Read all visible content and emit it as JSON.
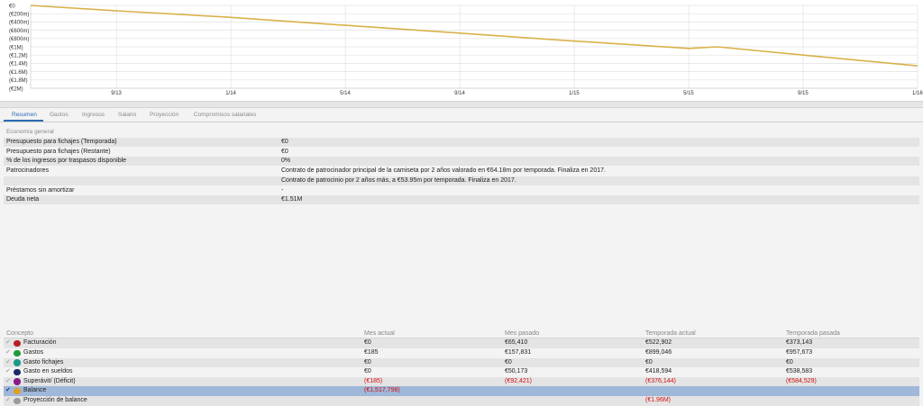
{
  "chart_data": {
    "type": "line",
    "x": [
      "6/13",
      "9/13",
      "1/14",
      "5/14",
      "9/14",
      "1/15",
      "5/15",
      "6/15",
      "9/15",
      "1/16"
    ],
    "y": [
      0,
      -130000,
      -290000,
      -480000,
      -670000,
      -860000,
      -1040000,
      -1000000,
      -1200000,
      -1460000
    ],
    "y_ticks": [
      "€0",
      "(€200m)",
      "(€400m)",
      "(€600m)",
      "(€800m)",
      "(€1M)",
      "(€1.2M)",
      "(€1.4M)",
      "(€1.6M)",
      "(€1.8M)",
      "(€2M)"
    ],
    "x_ticks": [
      "9/13",
      "1/14",
      "5/14",
      "9/14",
      "1/15",
      "5/15",
      "9/15",
      "1/16"
    ],
    "ylim": [
      -2000000,
      0
    ],
    "grid": true,
    "line_color": "#d9b14a"
  },
  "tabs": [
    "Resumen",
    "Gastos",
    "Ingresos",
    "Salario",
    "Proyección",
    "Compromisos salariales"
  ],
  "economia": {
    "title": "Economía general",
    "rows": [
      {
        "label": "Presupuesto para fichajes (Temporada)",
        "value": "€0"
      },
      {
        "label": "Presupuesto para fichajes (Restante)",
        "value": "€0"
      },
      {
        "label": "% de los ingresos por traspasos disponible",
        "value": "0%"
      },
      {
        "label": "Patrocinadores",
        "value": "Contrato de patrocinador principal de la camiseta por 2 años valorado en €64.18m por temporada. Finaliza en 2017."
      },
      {
        "label": "",
        "value": "Contrato de patrocinio por 2 años más, a €53.95m por temporada. Finaliza en 2017."
      },
      {
        "label": "Préstamos sin amortizar",
        "value": "-"
      },
      {
        "label": "Deuda neta",
        "value": "€1.51M"
      }
    ]
  },
  "table": {
    "headers": [
      "Concepto",
      "Mes actual",
      "Mes pasado",
      "Temporada actual",
      "Temporada pasada"
    ],
    "rows": [
      {
        "label": "Facturación",
        "color": "#b82020",
        "values": [
          "€0",
          "€65,410",
          "€522,902",
          "€373,143"
        ]
      },
      {
        "label": "Gastos",
        "color": "#1f9a3a",
        "values": [
          "€185",
          "€157,831",
          "€899,046",
          "€957,673"
        ]
      },
      {
        "label": "Gasto fichajes",
        "color": "#1a9a8a",
        "values": [
          "€0",
          "€0",
          "€0",
          "€0"
        ]
      },
      {
        "label": "Gasto en sueldos",
        "color": "#1a2a6a",
        "values": [
          "€0",
          "€50,173",
          "€418,594",
          "€538,583"
        ]
      },
      {
        "label": "Superávit/ (Déficit)",
        "color": "#8a1a8a",
        "values": [
          "(€185)",
          "(€92,421)",
          "(€376,144)",
          "(€584,529)"
        ]
      },
      {
        "label": "Balance",
        "color": "#e0a020",
        "values": [
          "(€1,517,798)",
          "",
          "",
          ""
        ]
      },
      {
        "label": "Proyección de balance",
        "color": "#9a9a9a",
        "values": [
          "",
          "",
          "(€1.96M)",
          ""
        ]
      }
    ]
  }
}
